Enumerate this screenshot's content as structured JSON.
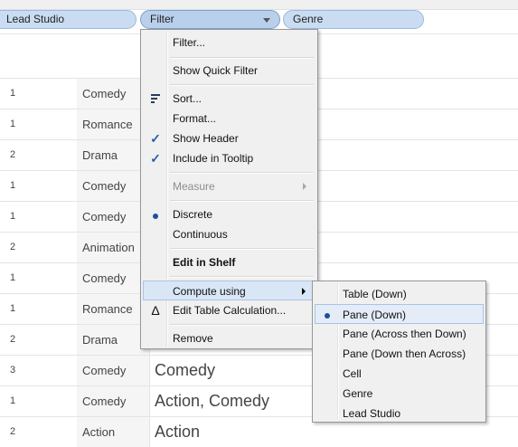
{
  "shelf": {
    "pills": [
      {
        "label": "Lead Studio"
      },
      {
        "label": "Filter"
      },
      {
        "label": "Genre"
      }
    ]
  },
  "table": {
    "rows": [
      {
        "count": "1",
        "genre": "Comedy",
        "value": ""
      },
      {
        "count": "1",
        "genre": "Romance",
        "value": ""
      },
      {
        "count": "2",
        "genre": "Drama",
        "value": ""
      },
      {
        "count": "1",
        "genre": "Comedy",
        "value": ""
      },
      {
        "count": "1",
        "genre": "Comedy",
        "value": ""
      },
      {
        "count": "2",
        "genre": "Animation",
        "value": ""
      },
      {
        "count": "1",
        "genre": "Comedy",
        "value": ""
      },
      {
        "count": "1",
        "genre": "Romance",
        "value": ""
      },
      {
        "count": "2",
        "genre": "Drama",
        "value": ""
      },
      {
        "count": "3",
        "genre": "Comedy",
        "value": "Comedy"
      },
      {
        "count": "1",
        "genre": "Comedy",
        "value": "Action, Comedy"
      },
      {
        "count": "2",
        "genre": "Action",
        "value": "Action"
      }
    ]
  },
  "context_menu": {
    "items": [
      {
        "label": "Filter..."
      },
      {
        "label": "Show Quick Filter"
      },
      {
        "label": "Sort...",
        "icon": "sort-icon"
      },
      {
        "label": "Format..."
      },
      {
        "label": "Show Header",
        "icon": "checkmark-icon",
        "checked": true
      },
      {
        "label": "Include in Tooltip",
        "icon": "checkmark-icon",
        "checked": true
      },
      {
        "label": "Measure",
        "disabled": true,
        "submenu": true
      },
      {
        "label": "Discrete",
        "icon": "radio-dot-icon",
        "selected": true
      },
      {
        "label": "Continuous"
      },
      {
        "label": "Edit in Shelf",
        "bold": true
      },
      {
        "label": "Compute using",
        "submenu": true,
        "highlighted": true
      },
      {
        "label": "Edit Table Calculation...",
        "icon": "delta-icon",
        "icon_glyph": "Δ"
      },
      {
        "label": "Remove"
      }
    ]
  },
  "submenu": {
    "items": [
      {
        "label": "Table (Down)"
      },
      {
        "label": "Pane (Down)",
        "selected": true
      },
      {
        "label": "Pane (Across then Down)"
      },
      {
        "label": "Pane (Down then Across)"
      },
      {
        "label": "Cell"
      },
      {
        "label": "Genre"
      },
      {
        "label": "Lead Studio"
      }
    ]
  },
  "colors": {
    "pill_bg": "#c9dcf1",
    "pill_border": "#9db9db",
    "menu_bg": "#f0f0f0",
    "highlight": "#d9e6f5",
    "check": "#2a5db0"
  }
}
